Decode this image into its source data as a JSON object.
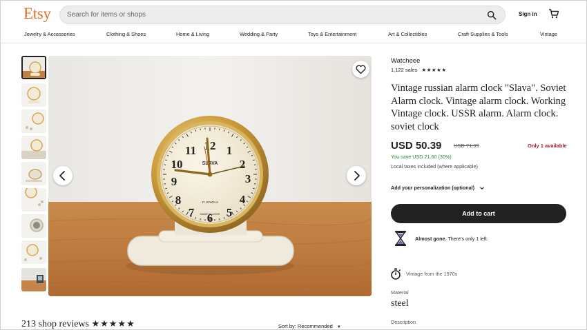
{
  "header": {
    "logo": "Etsy",
    "search_placeholder": "Search for items or shops",
    "signin_label": "Sign in"
  },
  "nav": [
    "Jewelry & Accessories",
    "Clothing & Shoes",
    "Home & Living",
    "Wedding & Party",
    "Toys & Entertainment",
    "Art & Collectibles",
    "Craft Supplies & Tools",
    "Vintage"
  ],
  "product": {
    "shop_name": "Watcheee",
    "sales": "1,122 sales",
    "stars": "★★★★★",
    "title": "Vintage russian alarm clock \"Slava\". Soviet Alarm clock. Vintage alarm clock. Working Vintage clock. USSR alarm. Alarm clock. soviet clock",
    "price": "USD 50.39",
    "original_price": "USD 71.99",
    "stock_note": "Only 1 available",
    "savings": "You save USD 21.60 (30%)",
    "tax_note": "Local taxes included (where applicable)",
    "personalization": "Add your personalization (optional)",
    "add_to_cart": "Add to cart",
    "almost_gone_bold": "Almost gone.",
    "almost_gone_rest": " There's only 1 left.",
    "vintage_note": "Vintage from the 1970s",
    "material_label": "Material",
    "material_value": "steel",
    "description_label": "Description"
  },
  "reviews": {
    "count_label": "213 shop reviews",
    "stars": "★★★★★",
    "sort_label": "Sort by: Recommended",
    "sort_caret": "▼"
  },
  "clock_image": {
    "brand": "SLAVA",
    "jewels": "11 JEWELS",
    "made_in": "MADE IN USSR",
    "numbers": [
      "12",
      "1",
      "2",
      "3",
      "4",
      "5",
      "6",
      "7",
      "8",
      "9",
      "10",
      "11"
    ]
  },
  "colors": {
    "brand": "#e26e1f",
    "price_green": "#258635",
    "stock_red": "#a61a2e",
    "button": "#222222"
  }
}
